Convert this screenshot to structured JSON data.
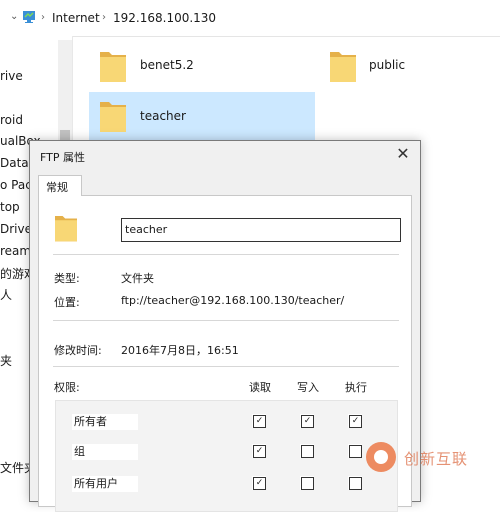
{
  "address_bar": {
    "crumbs": [
      "Internet",
      "192.168.100.130"
    ]
  },
  "nav_pane": {
    "items": [
      "rive",
      "roid",
      "ualBox",
      "Data",
      "o Packa",
      "top",
      "Drive",
      "ream",
      "的游戏",
      "人",
      "夹",
      "文件夹"
    ]
  },
  "files": [
    {
      "name": "benet5.2"
    },
    {
      "name": "public"
    },
    {
      "name": "teacher",
      "selected": true
    }
  ],
  "dialog": {
    "title": "FTP 属性",
    "close_glyph": "✕",
    "tab": "常规",
    "name_value": "teacher",
    "type_label": "类型:",
    "type_value": "文件夹",
    "location_label": "位置:",
    "location_value": "ftp://teacher@192.168.100.130/teacher/",
    "modified_label": "修改时间:",
    "modified_value": "2016年7月8日，16:51",
    "permissions": {
      "label": "权限:",
      "columns": [
        "读取",
        "写入",
        "执行"
      ],
      "rows": [
        {
          "name": "所有者",
          "read": true,
          "write": true,
          "exec": true
        },
        {
          "name": "组",
          "read": true,
          "write": false,
          "exec": false
        },
        {
          "name": "所有用户",
          "read": true,
          "write": false,
          "exec": false
        }
      ]
    }
  },
  "watermark": {
    "text": "创新互联"
  },
  "colors": {
    "selection": "#cce8ff",
    "folder": "#f4c96a"
  }
}
